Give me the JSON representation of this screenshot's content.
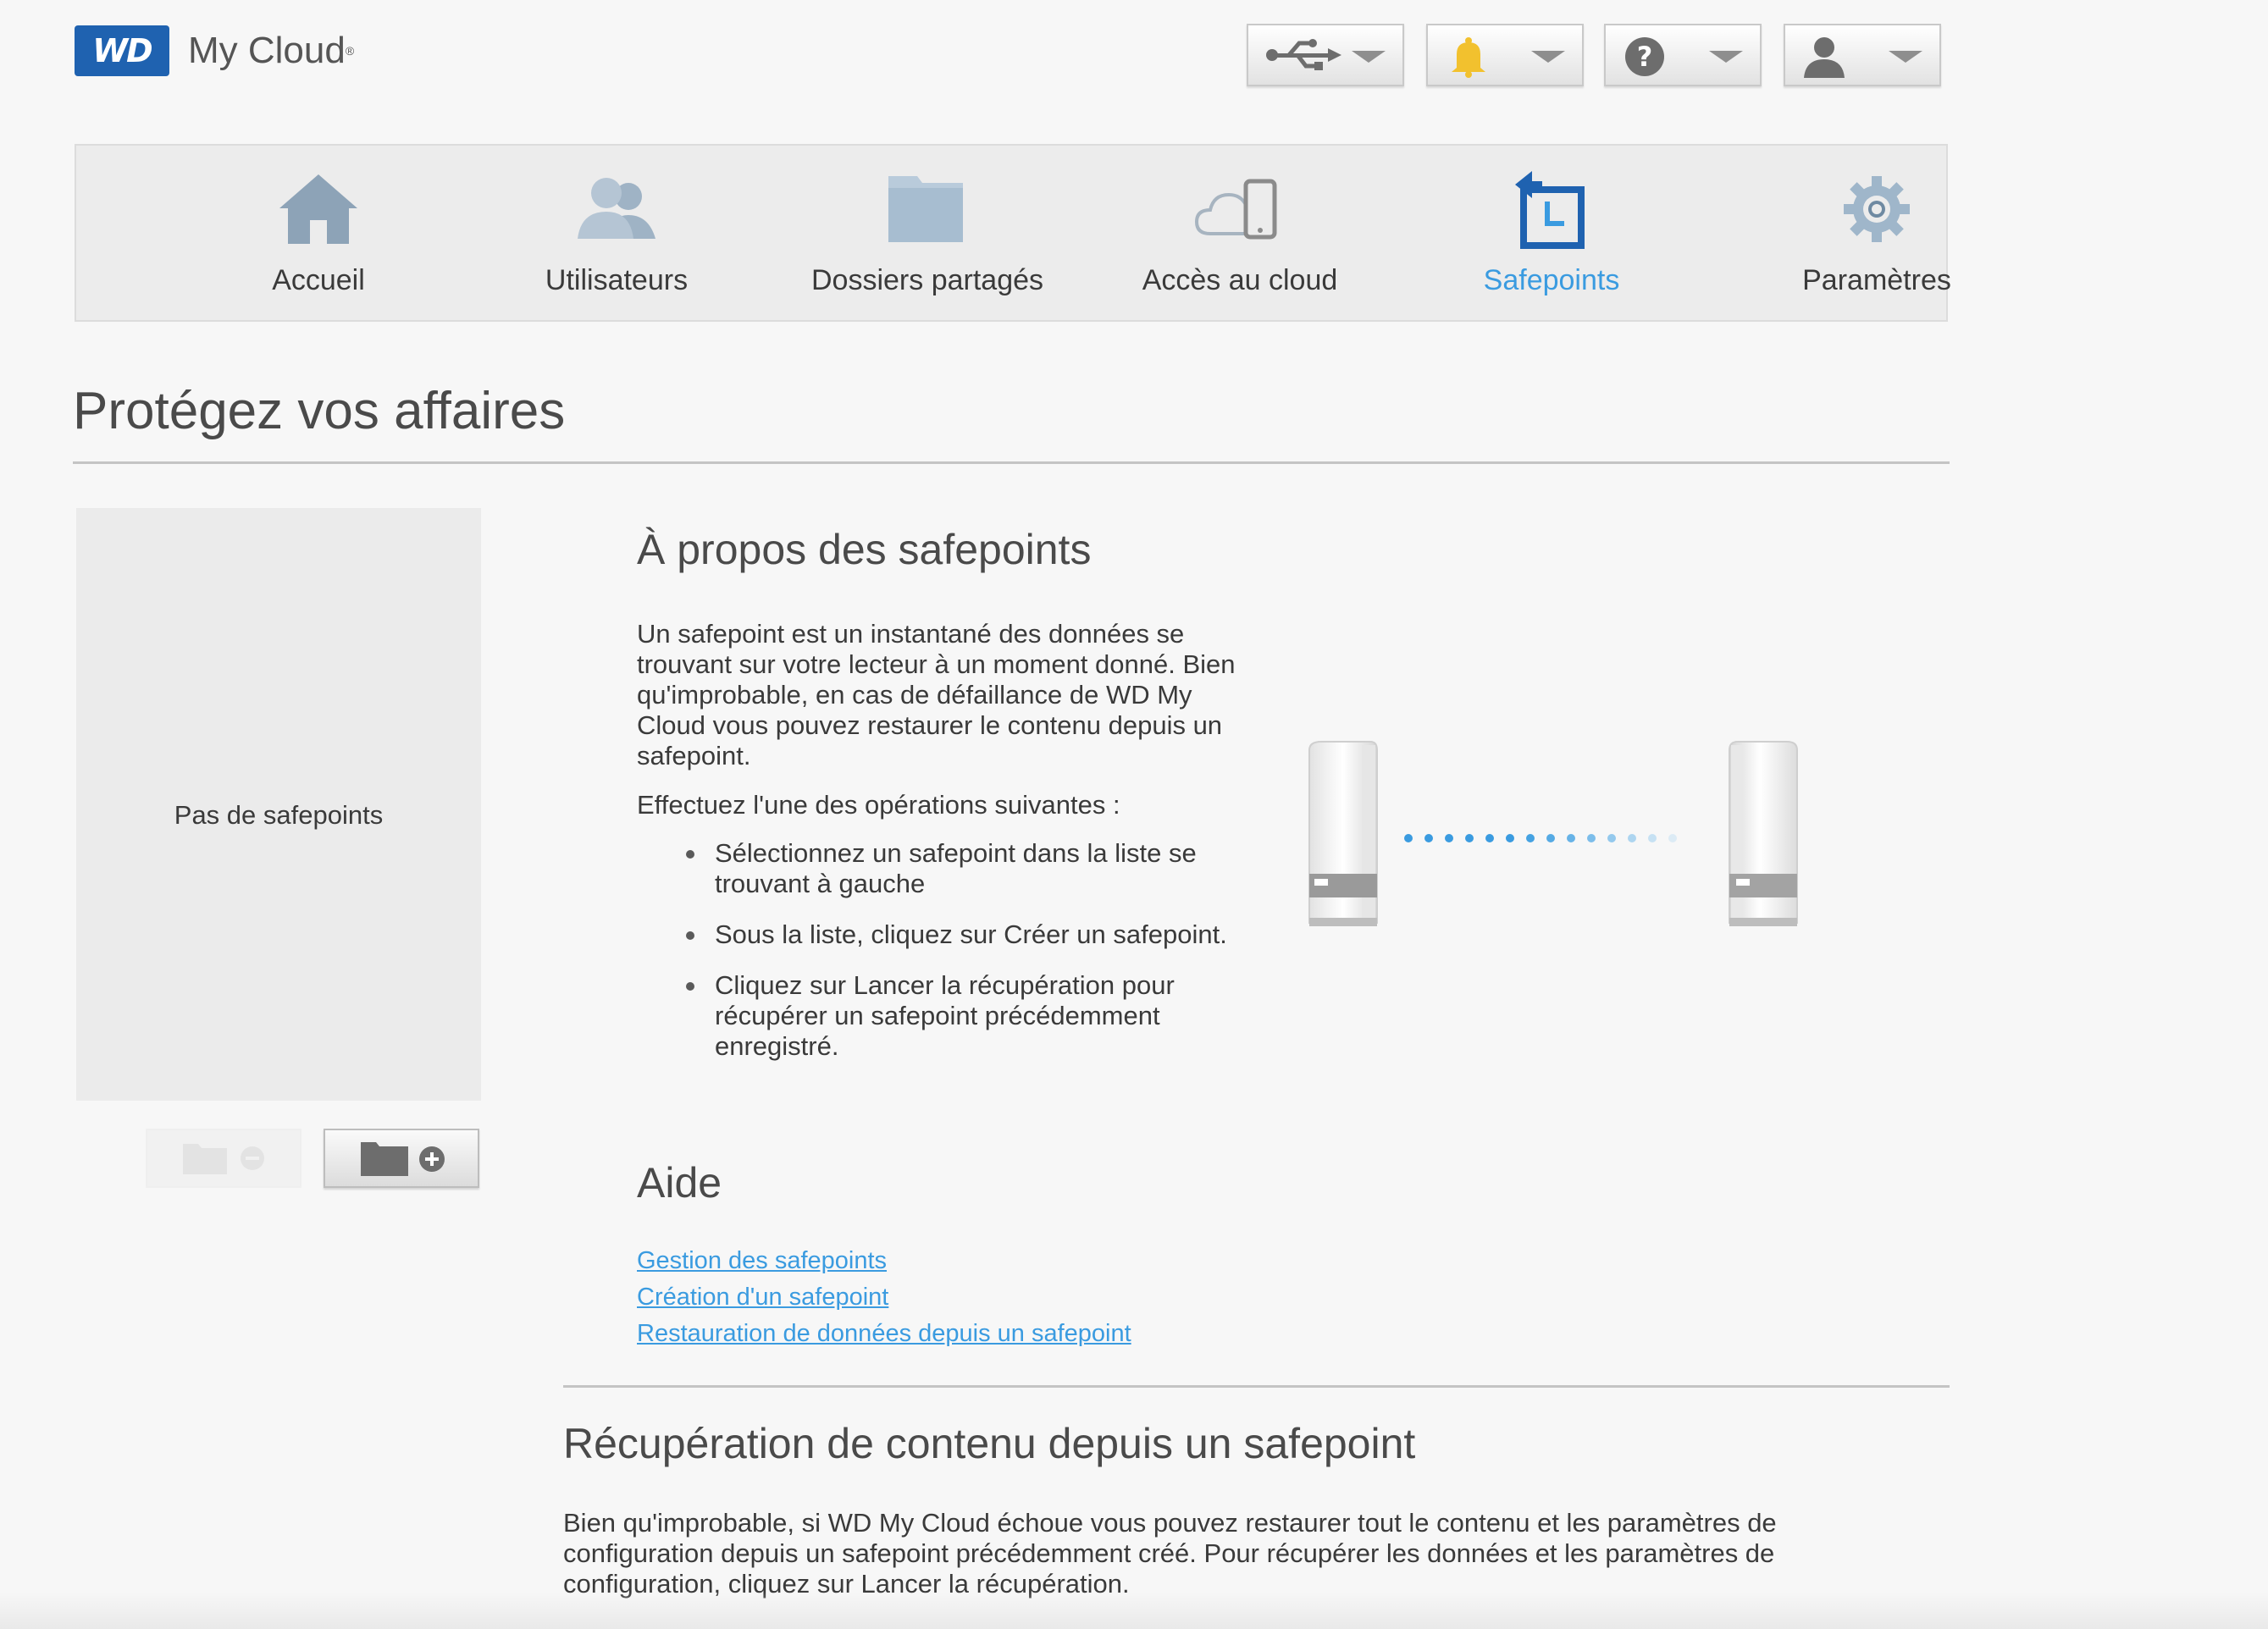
{
  "header": {
    "logo_text": "WD",
    "brand": "My Cloud",
    "brand_mark": "®",
    "buttons": [
      {
        "name": "usb-menu-button",
        "icon": "usb-icon"
      },
      {
        "name": "alerts-menu-button",
        "icon": "bell-icon",
        "color": "#f2c12e"
      },
      {
        "name": "help-menu-button",
        "icon": "help-icon"
      },
      {
        "name": "user-menu-button",
        "icon": "user-icon"
      }
    ]
  },
  "nav": {
    "items": [
      {
        "label": "Accueil",
        "icon": "home-icon"
      },
      {
        "label": "Utilisateurs",
        "icon": "users-icon"
      },
      {
        "label": "Dossiers partagés",
        "icon": "folder-icon"
      },
      {
        "label": "Accès au cloud",
        "icon": "cloud-device-icon"
      },
      {
        "label": "Safepoints",
        "icon": "safepoint-icon",
        "active": true
      },
      {
        "label": "Paramètres",
        "icon": "gear-icon"
      }
    ],
    "active_color": "#3a9be0"
  },
  "page": {
    "title": "Protégez vos affaires"
  },
  "safepoints": {
    "empty_text": "Pas de safepoints",
    "remove_icon": "folder-remove-icon",
    "add_icon": "folder-add-icon"
  },
  "about": {
    "title": "À propos des safepoints",
    "p1": "Un safepoint est un instantané des données se trouvant sur votre lecteur à un moment donné. Bien qu'improbable, en cas de défaillance de WD My Cloud vous pouvez restaurer le contenu depuis un safepoint.",
    "p2": "Effectuez l'une des opérations suivantes :",
    "bullets": [
      "Sélectionnez un safepoint dans la liste se trouvant à gauche",
      "Sous la liste, cliquez sur Créer un safepoint.",
      "Cliquez sur Lancer la récupération pour récupérer un safepoint précédemment enregistré."
    ]
  },
  "aide": {
    "title": "Aide",
    "links": [
      "Gestion des safepoints",
      "Création d'un safepoint",
      "Restauration de données depuis un safepoint"
    ]
  },
  "recuperation": {
    "title": "Récupération de contenu depuis un safepoint",
    "text": "Bien qu'improbable, si WD My Cloud échoue vous pouvez restaurer tout le contenu et les paramètres de configuration depuis un safepoint précédemment créé. Pour récupérer les données et les paramètres de configuration, cliquez sur Lancer la récupération."
  }
}
